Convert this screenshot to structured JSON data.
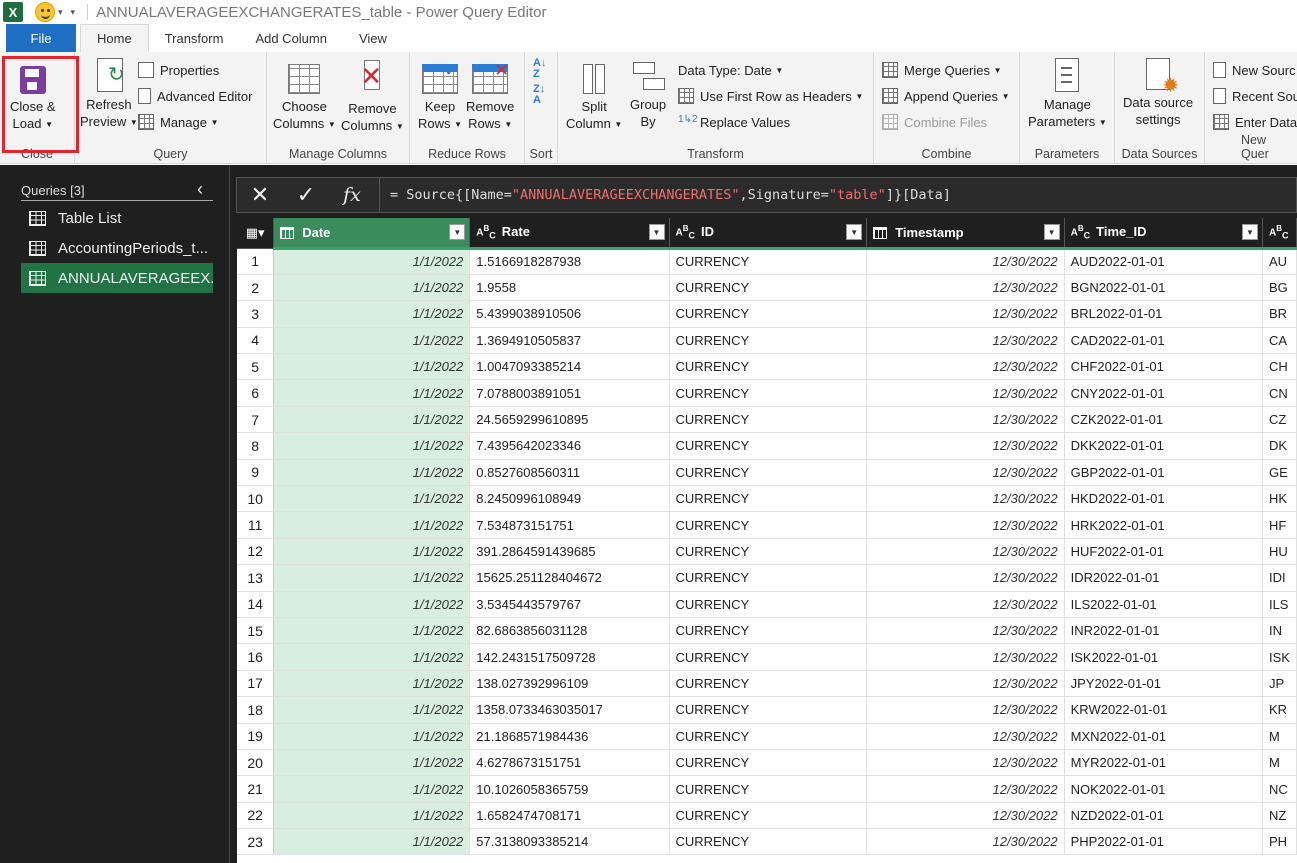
{
  "window": {
    "title": "ANNUALAVERAGEEXCHANGERATES_table - Power Query Editor",
    "app_icon_letter": "X"
  },
  "tabs": [
    {
      "label": "File"
    },
    {
      "label": "Home"
    },
    {
      "label": "Transform"
    },
    {
      "label": "Add Column"
    },
    {
      "label": "View"
    }
  ],
  "ribbon": {
    "close": {
      "label_line1": "Close &",
      "label_line2": "Load",
      "group": "Close"
    },
    "query": {
      "refresh_line1": "Refresh",
      "refresh_line2": "Preview",
      "properties": "Properties",
      "advanced_editor": "Advanced Editor",
      "manage": "Manage",
      "group": "Query"
    },
    "manage_columns": {
      "choose_line1": "Choose",
      "choose_line2": "Columns",
      "remove_line1": "Remove",
      "remove_line2": "Columns",
      "group": "Manage Columns"
    },
    "reduce_rows": {
      "keep_line1": "Keep",
      "keep_line2": "Rows",
      "remove_line1": "Remove",
      "remove_line2": "Rows",
      "group": "Reduce Rows"
    },
    "sort": {
      "group": "Sort",
      "az": "A",
      "za": "Z"
    },
    "transform": {
      "split_line1": "Split",
      "split_line2": "Column",
      "group_line1": "Group",
      "group_line2": "By",
      "data_type": "Data Type: Date",
      "first_row": "Use First Row as Headers",
      "replace": "Replace Values",
      "group": "Transform"
    },
    "combine": {
      "merge": "Merge Queries",
      "append": "Append Queries",
      "combine_files": "Combine Files",
      "group": "Combine"
    },
    "parameters": {
      "manage_line1": "Manage",
      "manage_line2": "Parameters",
      "group": "Parameters"
    },
    "data_sources": {
      "line1": "Data source",
      "line2": "settings",
      "group": "Data Sources"
    },
    "new_query": {
      "new_source": "New Sourc",
      "recent": "Recent Sou",
      "enter_data": "Enter Data",
      "group": "New Quer"
    }
  },
  "queries": {
    "header": "Queries [3]",
    "items": [
      {
        "label": "Table List"
      },
      {
        "label": "AccountingPeriods_t..."
      },
      {
        "label": "ANNUALAVERAGEEX..."
      }
    ]
  },
  "formula": {
    "prefix": "= Source{[Name=",
    "name_value": "\"ANNUALAVERAGEEXCHANGERATES\"",
    "mid": ",Signature=",
    "sig_value": "\"table\"",
    "suffix": "]}[Data]"
  },
  "columns": [
    {
      "name": "Date",
      "type_icon": "calendar-icon"
    },
    {
      "name": "Rate",
      "type_icon": "ABC"
    },
    {
      "name": "ID",
      "type_icon": "ABC"
    },
    {
      "name": "Timestamp",
      "type_icon": "calendar-icon"
    },
    {
      "name": "Time_ID",
      "type_icon": "ABC"
    },
    {
      "name": "",
      "type_icon": "ABC"
    }
  ],
  "rows": [
    {
      "n": "1",
      "date": "1/1/2022",
      "rate": "1.5166918287938",
      "id": "CURRENCY",
      "ts": "12/30/2022",
      "tid": "AUD2022-01-01",
      "extra": "AU"
    },
    {
      "n": "2",
      "date": "1/1/2022",
      "rate": "1.9558",
      "id": "CURRENCY",
      "ts": "12/30/2022",
      "tid": "BGN2022-01-01",
      "extra": "BG"
    },
    {
      "n": "3",
      "date": "1/1/2022",
      "rate": "5.4399038910506",
      "id": "CURRENCY",
      "ts": "12/30/2022",
      "tid": "BRL2022-01-01",
      "extra": "BR"
    },
    {
      "n": "4",
      "date": "1/1/2022",
      "rate": "1.3694910505837",
      "id": "CURRENCY",
      "ts": "12/30/2022",
      "tid": "CAD2022-01-01",
      "extra": "CA"
    },
    {
      "n": "5",
      "date": "1/1/2022",
      "rate": "1.0047093385214",
      "id": "CURRENCY",
      "ts": "12/30/2022",
      "tid": "CHF2022-01-01",
      "extra": "CH"
    },
    {
      "n": "6",
      "date": "1/1/2022",
      "rate": "7.0788003891051",
      "id": "CURRENCY",
      "ts": "12/30/2022",
      "tid": "CNY2022-01-01",
      "extra": "CN"
    },
    {
      "n": "7",
      "date": "1/1/2022",
      "rate": "24.5659299610895",
      "id": "CURRENCY",
      "ts": "12/30/2022",
      "tid": "CZK2022-01-01",
      "extra": "CZ"
    },
    {
      "n": "8",
      "date": "1/1/2022",
      "rate": "7.4395642023346",
      "id": "CURRENCY",
      "ts": "12/30/2022",
      "tid": "DKK2022-01-01",
      "extra": "DK"
    },
    {
      "n": "9",
      "date": "1/1/2022",
      "rate": "0.8527608560311",
      "id": "CURRENCY",
      "ts": "12/30/2022",
      "tid": "GBP2022-01-01",
      "extra": "GE"
    },
    {
      "n": "10",
      "date": "1/1/2022",
      "rate": "8.2450996108949",
      "id": "CURRENCY",
      "ts": "12/30/2022",
      "tid": "HKD2022-01-01",
      "extra": "HK"
    },
    {
      "n": "11",
      "date": "1/1/2022",
      "rate": "7.534873151751",
      "id": "CURRENCY",
      "ts": "12/30/2022",
      "tid": "HRK2022-01-01",
      "extra": "HF"
    },
    {
      "n": "12",
      "date": "1/1/2022",
      "rate": "391.2864591439685",
      "id": "CURRENCY",
      "ts": "12/30/2022",
      "tid": "HUF2022-01-01",
      "extra": "HU"
    },
    {
      "n": "13",
      "date": "1/1/2022",
      "rate": "15625.251128404672",
      "id": "CURRENCY",
      "ts": "12/30/2022",
      "tid": "IDR2022-01-01",
      "extra": "IDI"
    },
    {
      "n": "14",
      "date": "1/1/2022",
      "rate": "3.5345443579767",
      "id": "CURRENCY",
      "ts": "12/30/2022",
      "tid": "ILS2022-01-01",
      "extra": "ILS"
    },
    {
      "n": "15",
      "date": "1/1/2022",
      "rate": "82.6863856031128",
      "id": "CURRENCY",
      "ts": "12/30/2022",
      "tid": "INR2022-01-01",
      "extra": "IN"
    },
    {
      "n": "16",
      "date": "1/1/2022",
      "rate": "142.2431517509728",
      "id": "CURRENCY",
      "ts": "12/30/2022",
      "tid": "ISK2022-01-01",
      "extra": "ISK"
    },
    {
      "n": "17",
      "date": "1/1/2022",
      "rate": "138.027392996109",
      "id": "CURRENCY",
      "ts": "12/30/2022",
      "tid": "JPY2022-01-01",
      "extra": "JP"
    },
    {
      "n": "18",
      "date": "1/1/2022",
      "rate": "1358.0733463035017",
      "id": "CURRENCY",
      "ts": "12/30/2022",
      "tid": "KRW2022-01-01",
      "extra": "KR"
    },
    {
      "n": "19",
      "date": "1/1/2022",
      "rate": "21.1868571984436",
      "id": "CURRENCY",
      "ts": "12/30/2022",
      "tid": "MXN2022-01-01",
      "extra": "M"
    },
    {
      "n": "20",
      "date": "1/1/2022",
      "rate": "4.6278673151751",
      "id": "CURRENCY",
      "ts": "12/30/2022",
      "tid": "MYR2022-01-01",
      "extra": "M"
    },
    {
      "n": "21",
      "date": "1/1/2022",
      "rate": "10.1026058365759",
      "id": "CURRENCY",
      "ts": "12/30/2022",
      "tid": "NOK2022-01-01",
      "extra": "NC"
    },
    {
      "n": "22",
      "date": "1/1/2022",
      "rate": "1.6582474708171",
      "id": "CURRENCY",
      "ts": "12/30/2022",
      "tid": "NZD2022-01-01",
      "extra": "NZ"
    },
    {
      "n": "23",
      "date": "1/1/2022",
      "rate": "57.3138093385214",
      "id": "CURRENCY",
      "ts": "12/30/2022",
      "tid": "PHP2022-01-01",
      "extra": "PH"
    }
  ],
  "colors": {
    "accent_green": "#217346",
    "file_tab_blue": "#1f6fc5",
    "highlight_red": "#e3242b",
    "date_col_bg": "#d7eee0"
  }
}
